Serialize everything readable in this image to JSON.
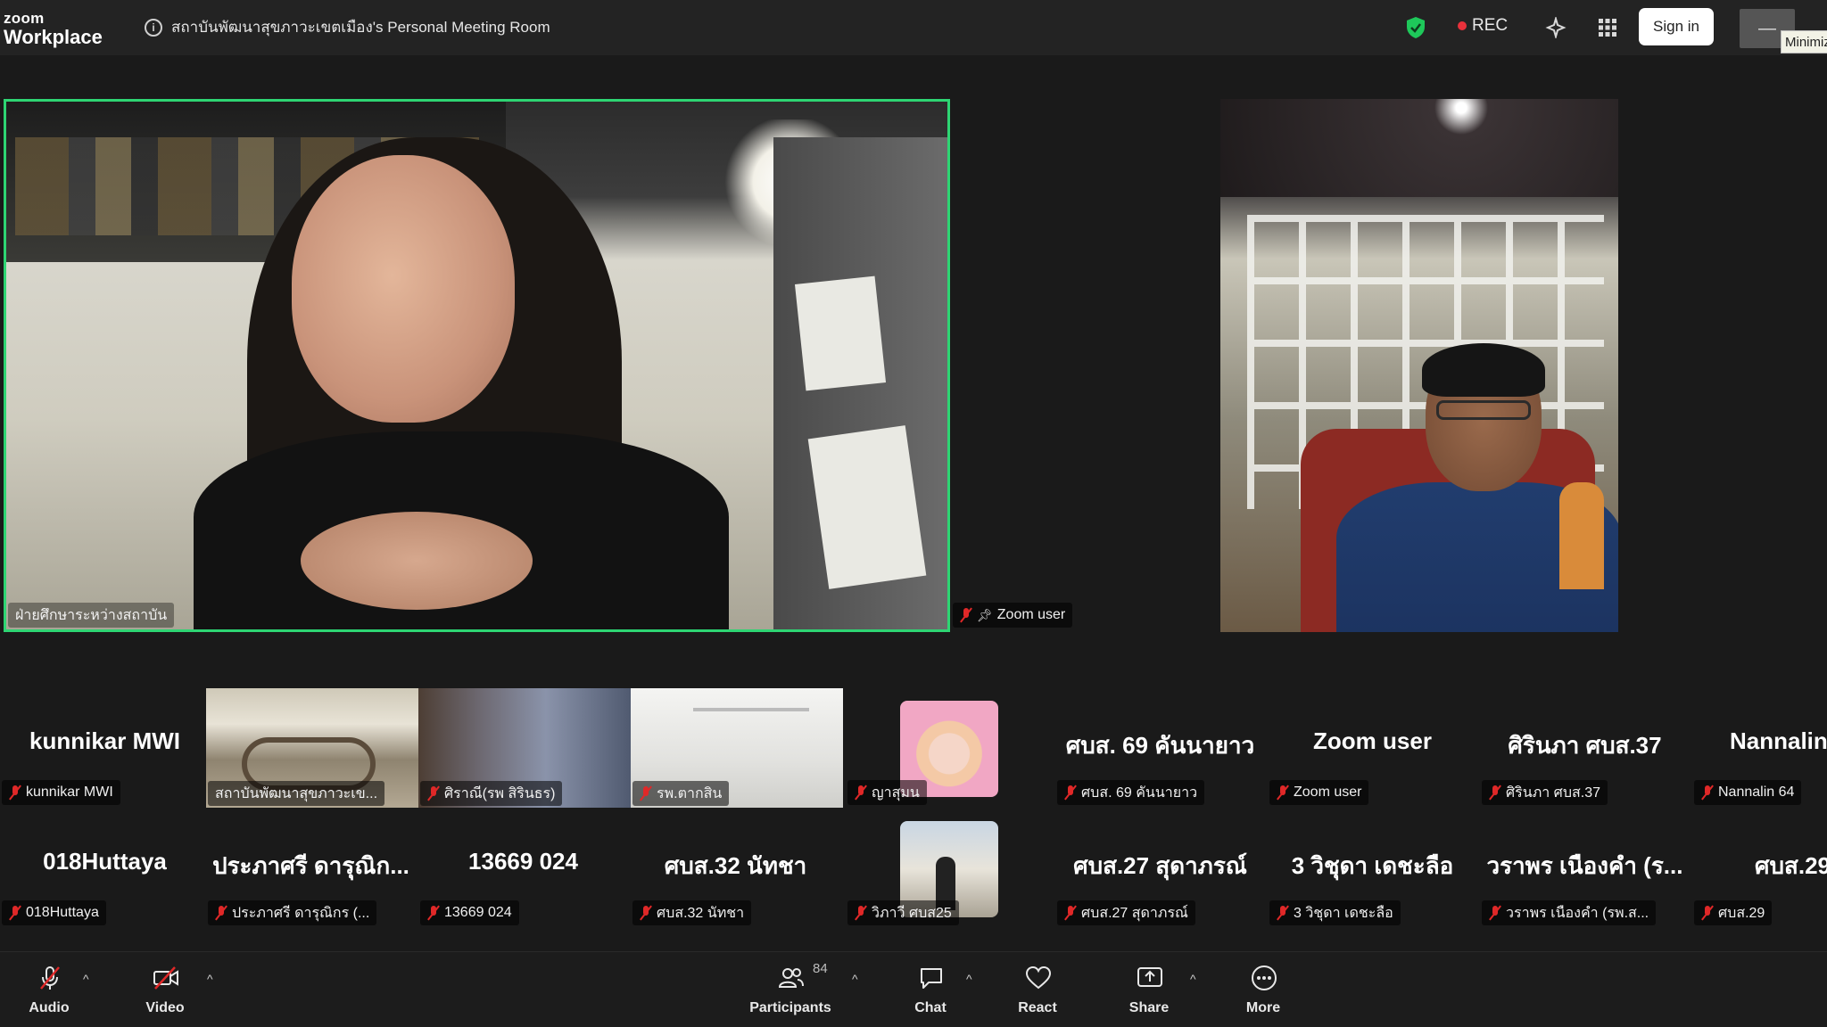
{
  "titlebar": {
    "brand_small": "zoom",
    "brand_big": "Workplace",
    "meeting_title": "สถาบันพัฒนาสุขภาวะเขตเมือง's Personal Meeting Room",
    "rec_label": "REC",
    "signin_label": "Sign in",
    "minimize_symbol": "—",
    "tooltip": "Minimize",
    "colors": {
      "shield": "#1ec85a",
      "rec_dot": "#e8313b"
    }
  },
  "videos": {
    "main_name": "ฝ่ายศึกษาระหว่างสถาบัน",
    "main_border_color": "#2ed573",
    "right_name": "Zoom user"
  },
  "gallery": {
    "row1": [
      {
        "big": "kunnikar MWI",
        "tag": "kunnikar MWI"
      },
      {
        "big": "",
        "tag": "สถาบันพัฒนาสุขภาวะเข..."
      },
      {
        "big": "",
        "tag": "ศิราณี(รพ สิรินธร)"
      },
      {
        "big": "",
        "tag": "รพ.ตากสิน"
      },
      {
        "big": "",
        "tag": "ญาสุมน"
      },
      {
        "big": "ศบส. 69 คันนายาว",
        "tag": "ศบส. 69 คันนายาว"
      },
      {
        "big": "Zoom user",
        "tag": "Zoom user"
      },
      {
        "big": "ศิรินภา ศบส.37",
        "tag": "ศิรินภา ศบส.37"
      },
      {
        "big": "Nannalin",
        "tag": "Nannalin 64"
      }
    ],
    "row2": [
      {
        "big": "018Huttaya",
        "tag": "018Huttaya"
      },
      {
        "big": "ประภาศรี ดารุณิก...",
        "tag": "ประภาศรี ดารุณิกร (..."
      },
      {
        "big": "13669 024",
        "tag": "13669 024"
      },
      {
        "big": "ศบส.32 นัทชา",
        "tag": "ศบส.32 นัทชา"
      },
      {
        "big": "",
        "tag": "วิภาวี ศบส25"
      },
      {
        "big": "ศบส.27 สุดาภรณ์",
        "tag": "ศบส.27 สุดาภรณ์"
      },
      {
        "big": "3 วิชุดา เดชะลือ",
        "tag": "3 วิชุดา เดชะลือ"
      },
      {
        "big": "วราพร เนืองคำ (ร...",
        "tag": "วราพร เนืองคำ (รพ.ส..."
      },
      {
        "big": "ศบส.29",
        "tag": "ศบส.29"
      }
    ]
  },
  "toolbar": {
    "audio": "Audio",
    "video": "Video",
    "participants": "Participants",
    "participants_count": "84",
    "chat": "Chat",
    "react": "React",
    "share": "Share",
    "more": "More",
    "caret": "^"
  }
}
